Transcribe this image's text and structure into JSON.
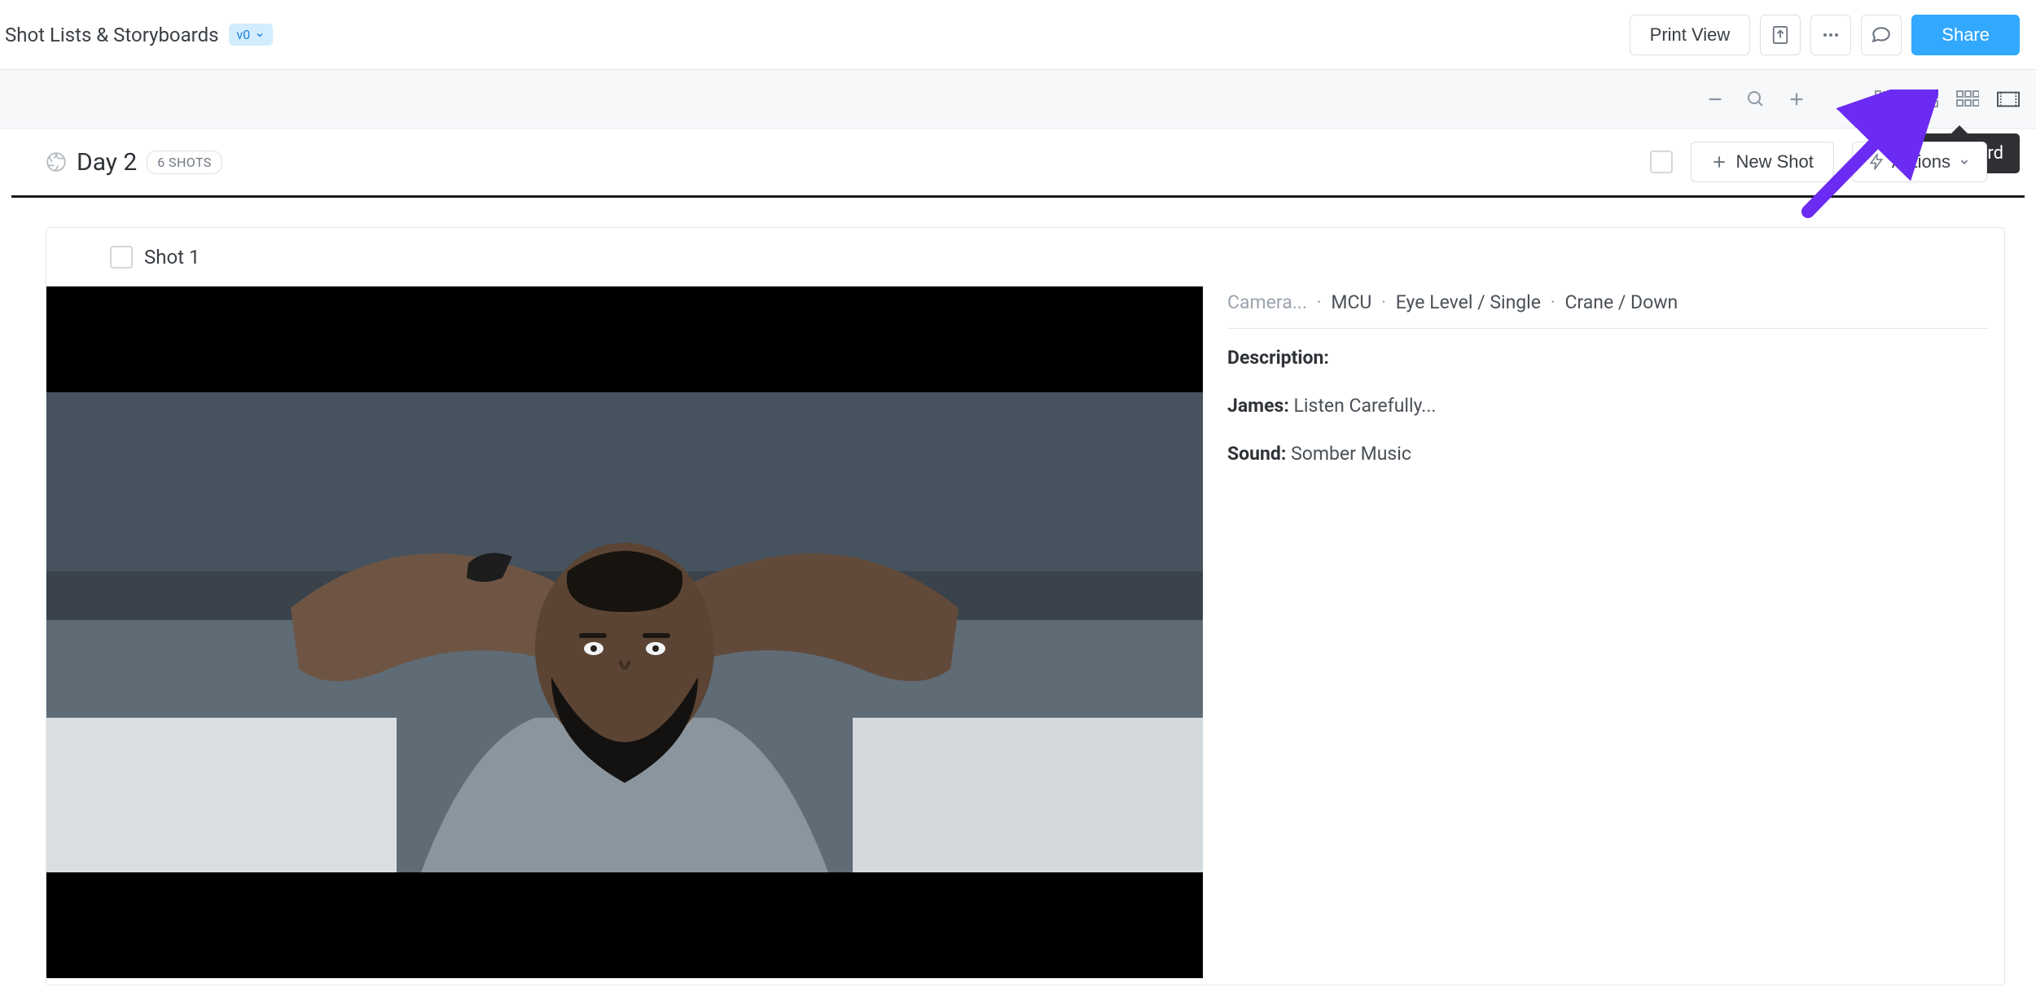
{
  "topbar": {
    "title": "Shot Lists & Storyboards",
    "version": "v0",
    "print_view": "Print View",
    "share": "Share"
  },
  "tooltip": "Storyboard",
  "section": {
    "title": "Day 2",
    "shot_count_label": "6 SHOTS",
    "new_shot": "New Shot",
    "actions": "Actions"
  },
  "shot": {
    "label": "Shot 1",
    "camera_prefix": "Camera...",
    "spec_shot_size": "MCU",
    "spec_angle": "Eye Level / Single",
    "spec_movement": "Crane / Down",
    "description_label": "Description:",
    "description_value": "",
    "dialogue_speaker": "James:",
    "dialogue_value": "Listen Carefully...",
    "sound_label": "Sound:",
    "sound_value": "Somber Music"
  }
}
